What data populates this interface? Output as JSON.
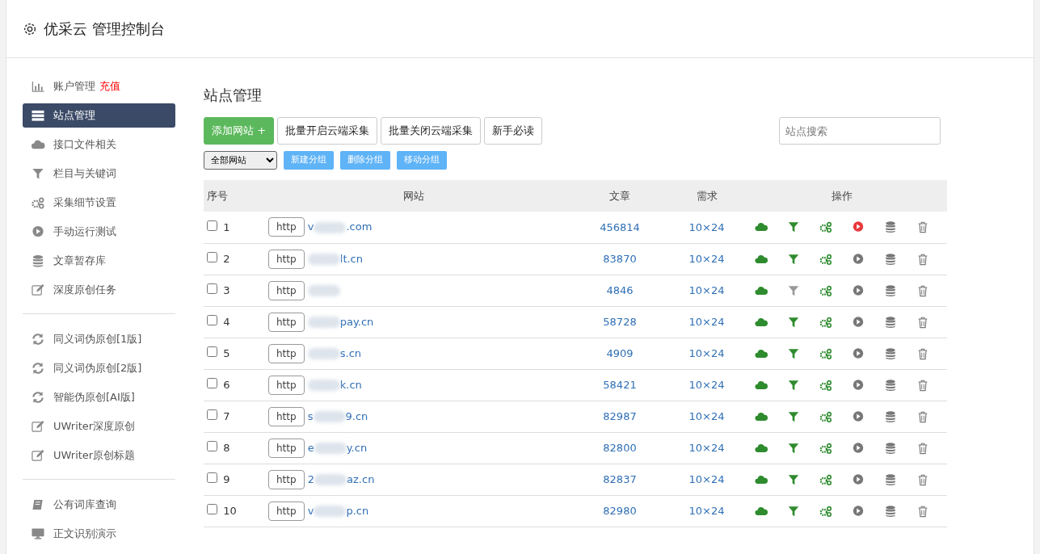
{
  "header": {
    "title": "优采云 管理控制台"
  },
  "sidebar": {
    "groups": [
      {
        "items": [
          {
            "kind": "chart",
            "label": "账户管理",
            "extra": "充值",
            "selected": false
          },
          {
            "kind": "server",
            "label": "站点管理",
            "selected": true
          },
          {
            "kind": "cloud",
            "label": "接口文件相关",
            "selected": false
          },
          {
            "kind": "filter",
            "label": "栏目与关键词",
            "selected": false
          },
          {
            "kind": "gears",
            "label": "采集细节设置",
            "selected": false
          },
          {
            "kind": "play",
            "label": "手动运行测试",
            "selected": false
          },
          {
            "kind": "db",
            "label": "文章暂存库",
            "selected": false
          },
          {
            "kind": "edit",
            "label": "深度原创任务",
            "selected": false
          }
        ]
      },
      {
        "items": [
          {
            "kind": "refresh",
            "label": "同义词伪原创[1版]",
            "selected": false
          },
          {
            "kind": "refresh",
            "label": "同义词伪原创[2版]",
            "selected": false
          },
          {
            "kind": "refresh",
            "label": "智能伪原创[AI版]",
            "selected": false
          },
          {
            "kind": "edit",
            "label": "UWriter深度原创",
            "selected": false
          },
          {
            "kind": "edit",
            "label": "UWriter原创标题",
            "selected": false
          }
        ]
      },
      {
        "items": [
          {
            "kind": "book",
            "label": "公有词库查询",
            "selected": false
          },
          {
            "kind": "monitor",
            "label": "正文识别演示",
            "selected": false
          }
        ]
      }
    ]
  },
  "main": {
    "title": "站点管理",
    "toolbar": [
      {
        "kind": "primary",
        "label": "添加网站 +"
      },
      {
        "kind": "outline",
        "label": "批量开启云端采集"
      },
      {
        "kind": "outline",
        "label": "批量关闭云端采集"
      },
      {
        "kind": "outline",
        "label": "新手必读"
      }
    ],
    "search": {
      "placeholder": "站点搜索"
    },
    "group_select": {
      "value": "全部网站"
    },
    "group_buttons": [
      "新建分组",
      "删除分组",
      "移动分组"
    ],
    "table": {
      "columns": [
        "序号",
        "网站",
        "文章",
        "需求",
        "操作"
      ],
      "rows": [
        {
          "checked": false,
          "index": "1",
          "protocol": "http",
          "domain_start": "v",
          "domain_end": ".com",
          "articles": "456814",
          "demand": "10×24",
          "filter_on": true,
          "running": true
        },
        {
          "checked": false,
          "index": "2",
          "protocol": "http",
          "domain_end": "lt.cn",
          "articles": "83870",
          "demand": "10×24",
          "filter_on": true,
          "running": false
        },
        {
          "checked": false,
          "index": "3",
          "protocol": "http",
          "articles": "4846",
          "demand": "10×24",
          "filter_on": false,
          "running": false
        },
        {
          "checked": false,
          "index": "4",
          "protocol": "http",
          "domain_end": "pay.cn",
          "articles": "58728",
          "demand": "10×24",
          "filter_on": true,
          "running": false
        },
        {
          "checked": false,
          "index": "5",
          "protocol": "http",
          "domain_end": "s.cn",
          "articles": "4909",
          "demand": "10×24",
          "filter_on": true,
          "running": false
        },
        {
          "checked": false,
          "index": "6",
          "protocol": "http",
          "domain_end": "k.cn",
          "articles": "58421",
          "demand": "10×24",
          "filter_on": true,
          "running": false
        },
        {
          "checked": false,
          "index": "7",
          "protocol": "http",
          "domain_start": "s",
          "domain_end": "9.cn",
          "articles": "82987",
          "demand": "10×24",
          "filter_on": true,
          "running": false
        },
        {
          "checked": false,
          "index": "8",
          "protocol": "http",
          "domain_start": "e",
          "domain_end": "y.cn",
          "articles": "82800",
          "demand": "10×24",
          "filter_on": true,
          "running": false
        },
        {
          "checked": false,
          "index": "9",
          "protocol": "http",
          "domain_start": "2",
          "domain_end": "az.cn",
          "articles": "82837",
          "demand": "10×24",
          "filter_on": true,
          "running": false
        },
        {
          "checked": false,
          "index": "10",
          "protocol": "http",
          "domain_start": "v",
          "domain_end": "p.cn",
          "articles": "82980",
          "demand": "10×24",
          "filter_on": true,
          "running": false
        }
      ]
    }
  }
}
